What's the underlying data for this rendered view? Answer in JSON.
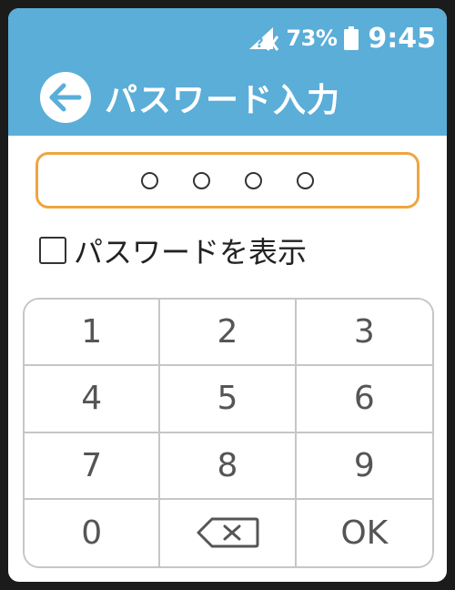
{
  "status_bar": {
    "signal_icon": "no-signal-icon",
    "battery_percent": "73%",
    "battery_icon": "battery-icon",
    "time": "9:45"
  },
  "header": {
    "back_icon": "back-arrow-icon",
    "title": "パスワード入力"
  },
  "password_field": {
    "digits_entered": 4,
    "mask_char": "○"
  },
  "show_password": {
    "checked": false,
    "label": "パスワードを表示"
  },
  "keypad": {
    "keys": [
      {
        "label": "1",
        "name": "key-1"
      },
      {
        "label": "2",
        "name": "key-2"
      },
      {
        "label": "3",
        "name": "key-3"
      },
      {
        "label": "4",
        "name": "key-4"
      },
      {
        "label": "5",
        "name": "key-5"
      },
      {
        "label": "6",
        "name": "key-6"
      },
      {
        "label": "7",
        "name": "key-7"
      },
      {
        "label": "8",
        "name": "key-8"
      },
      {
        "label": "9",
        "name": "key-9"
      },
      {
        "label": "0",
        "name": "key-0"
      },
      {
        "label": "",
        "name": "backspace-key",
        "icon": "backspace-icon"
      },
      {
        "label": "OK",
        "name": "ok-key"
      }
    ]
  },
  "colors": {
    "header_bg": "#5aaed8",
    "field_border": "#efa53e",
    "key_text": "#555555"
  }
}
